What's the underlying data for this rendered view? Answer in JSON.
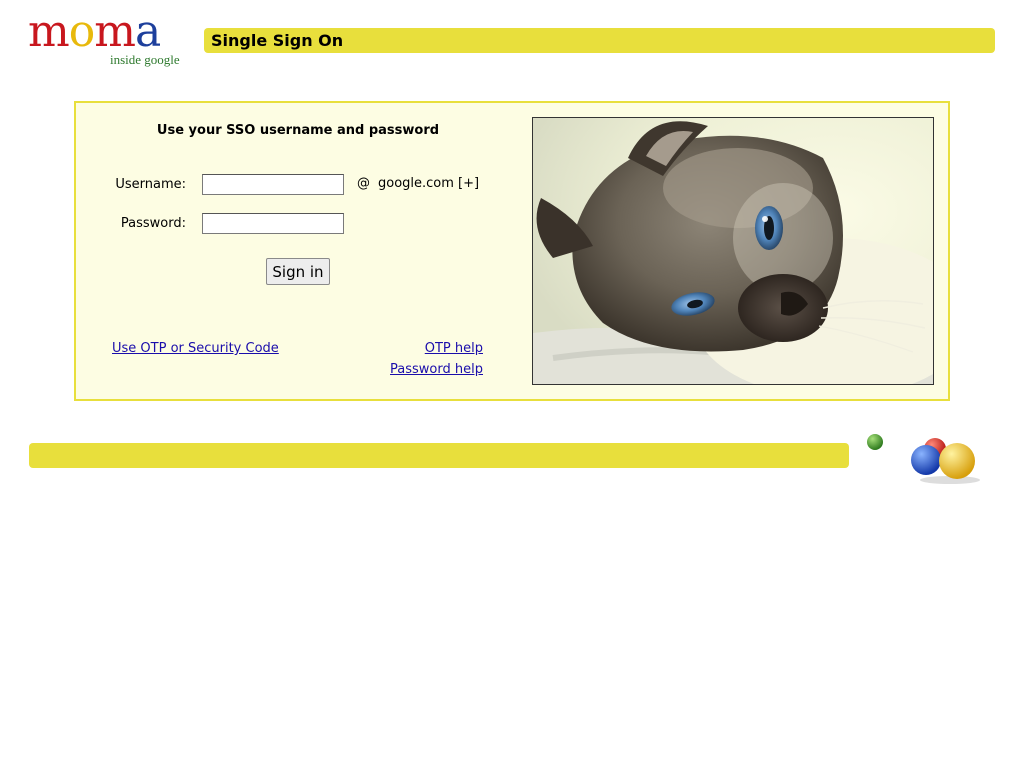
{
  "logo": {
    "letters": [
      "m",
      "o",
      "m",
      "a"
    ],
    "letter_colors": [
      "#c8171e",
      "#e8b90c",
      "#c8171e",
      "#1d3f9c"
    ],
    "tagline": "inside google"
  },
  "header": {
    "title": "Single Sign On"
  },
  "form": {
    "heading": "Use your SSO username and password",
    "username_label": "Username:",
    "password_label": "Password:",
    "username_value": "",
    "password_value": "",
    "at_sign": "@",
    "domain": "google.com [+]",
    "signin_label": "Sign in"
  },
  "links": {
    "otp_code": "Use OTP or Security Code",
    "otp_help": "OTP help",
    "password_help": "Password help"
  },
  "colors": {
    "accent_yellow": "#e8df3c",
    "panel_background": "#fdfde3",
    "link": "#1a0dab"
  },
  "icons": {
    "photo": "cat-photo",
    "balls": "colored-balls-icon"
  }
}
